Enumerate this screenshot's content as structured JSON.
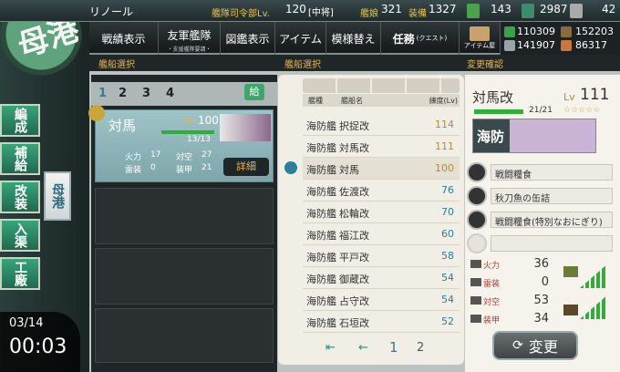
{
  "top": {
    "player_name": "リノール",
    "hq_label": "艦隊司令部Lv.",
    "hq_level": "120",
    "rank": "[中将]",
    "ships_label": "艦娘",
    "ships_count": "321",
    "equip_label": "装備",
    "equip_count": "1327",
    "bucket": "143",
    "dev_mat": "2987",
    "screw": "42"
  },
  "menu": [
    {
      "label": "戦績表示",
      "sub": ""
    },
    {
      "label": "友軍艦隊",
      "sub": "・支援艦隊要請・"
    },
    {
      "label": "図鑑表示",
      "sub": ""
    },
    {
      "label": "アイテム",
      "sub": ""
    },
    {
      "label": "模様替え",
      "sub": ""
    },
    {
      "label": "任務",
      "sub": "(クエスト)"
    },
    {
      "label": "アイテム屋",
      "sub": ""
    }
  ],
  "resources": {
    "fuel": "110309",
    "ammo": "152203",
    "steel": "141907",
    "bauxite": "86317"
  },
  "side": {
    "port": "母港",
    "buttons": [
      "編成",
      "補給",
      "改装",
      "入渠",
      "工廠"
    ],
    "bokou": "母港",
    "date": "03/14",
    "time": "00:03"
  },
  "headers": {
    "fleet": "艦船選択",
    "list": "艦船選択",
    "detail": "変更確認"
  },
  "fleet": {
    "tabs": [
      "1",
      "2",
      "3",
      "4"
    ],
    "supply": "給",
    "ship": {
      "name": "対馬",
      "lv_label": "Lv",
      "lv": "100",
      "hp": "13/13",
      "fp_lbl": "火力",
      "fp": "17",
      "aa_lbl": "対空",
      "aa": "27",
      "tp_lbl": "雷装",
      "tp": "0",
      "ar_lbl": "装甲",
      "ar": "21",
      "detail_btn": "詳細"
    }
  },
  "list": {
    "col_type": "艦種",
    "col_name": "艦船名",
    "col_lv": "練度(Lv)",
    "rows": [
      {
        "type": "海防艦",
        "name": "択捉改",
        "lv": "114"
      },
      {
        "type": "海防艦",
        "name": "対馬改",
        "lv": "111"
      },
      {
        "type": "海防艦",
        "name": "対馬",
        "lv": "100"
      },
      {
        "type": "海防艦",
        "name": "佐渡改",
        "lv": "76"
      },
      {
        "type": "海防艦",
        "name": "松輪改",
        "lv": "70"
      },
      {
        "type": "海防艦",
        "name": "福江改",
        "lv": "60"
      },
      {
        "type": "海防艦",
        "name": "平戸改",
        "lv": "58"
      },
      {
        "type": "海防艦",
        "name": "御蔵改",
        "lv": "54"
      },
      {
        "type": "海防艦",
        "name": "占守改",
        "lv": "54"
      },
      {
        "type": "海防艦",
        "name": "石垣改",
        "lv": "52"
      }
    ],
    "pages": [
      "1",
      "2"
    ]
  },
  "detail": {
    "name": "対馬改",
    "lv_label": "Lv",
    "lv": "111",
    "hp": "21/21",
    "stars": "☆☆☆☆☆",
    "banner": "海防",
    "equipment": [
      "戦闘糧食",
      "秋刀魚の缶詰",
      "戦闘糧食(特別なおにぎり)",
      ""
    ],
    "stats": [
      {
        "label": "火力",
        "value": "36"
      },
      {
        "label": "雷装",
        "value": "0"
      },
      {
        "label": "対空",
        "value": "53"
      },
      {
        "label": "装甲",
        "value": "34"
      }
    ],
    "change_btn": "変更"
  },
  "colors": {
    "accent": "#e5b54a",
    "green": "#2fae3a",
    "lvblue": "#2a7f9a"
  }
}
